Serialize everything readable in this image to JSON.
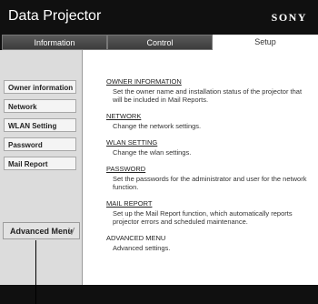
{
  "app": {
    "title": "Data Projector",
    "brand": "SONY"
  },
  "tabs": [
    {
      "label": "Information"
    },
    {
      "label": "Control"
    },
    {
      "label": "Setup"
    }
  ],
  "sidebar": {
    "items": [
      {
        "label": "Owner information"
      },
      {
        "label": "Network"
      },
      {
        "label": "WLAN Setting"
      },
      {
        "label": "Password"
      },
      {
        "label": "Mail Report"
      }
    ],
    "advanced": {
      "label": "Advanced Menu",
      "icon": "double-chevron-down-icon"
    }
  },
  "sections": [
    {
      "title": "OWNER INFORMATION",
      "desc": "Set the owner name and installation status of the projector that will be included in Mail Reports."
    },
    {
      "title": "NETWORK",
      "desc": "Change the network settings."
    },
    {
      "title": "WLAN SETTING",
      "desc": "Change the wlan settings."
    },
    {
      "title": "PASSWORD",
      "desc": "Set the passwords for the administrator and user for the network function."
    },
    {
      "title": "MAIL REPORT",
      "desc": "Set up the Mail Report function, which automatically reports projector errors and scheduled maintenance."
    },
    {
      "title": "ADVANCED MENU",
      "desc": "Advanced settings."
    }
  ],
  "colors": {
    "header_bg": "#101010",
    "sidebar_bg": "#dcdcdc",
    "active_tab_bg": "#ffffff"
  }
}
